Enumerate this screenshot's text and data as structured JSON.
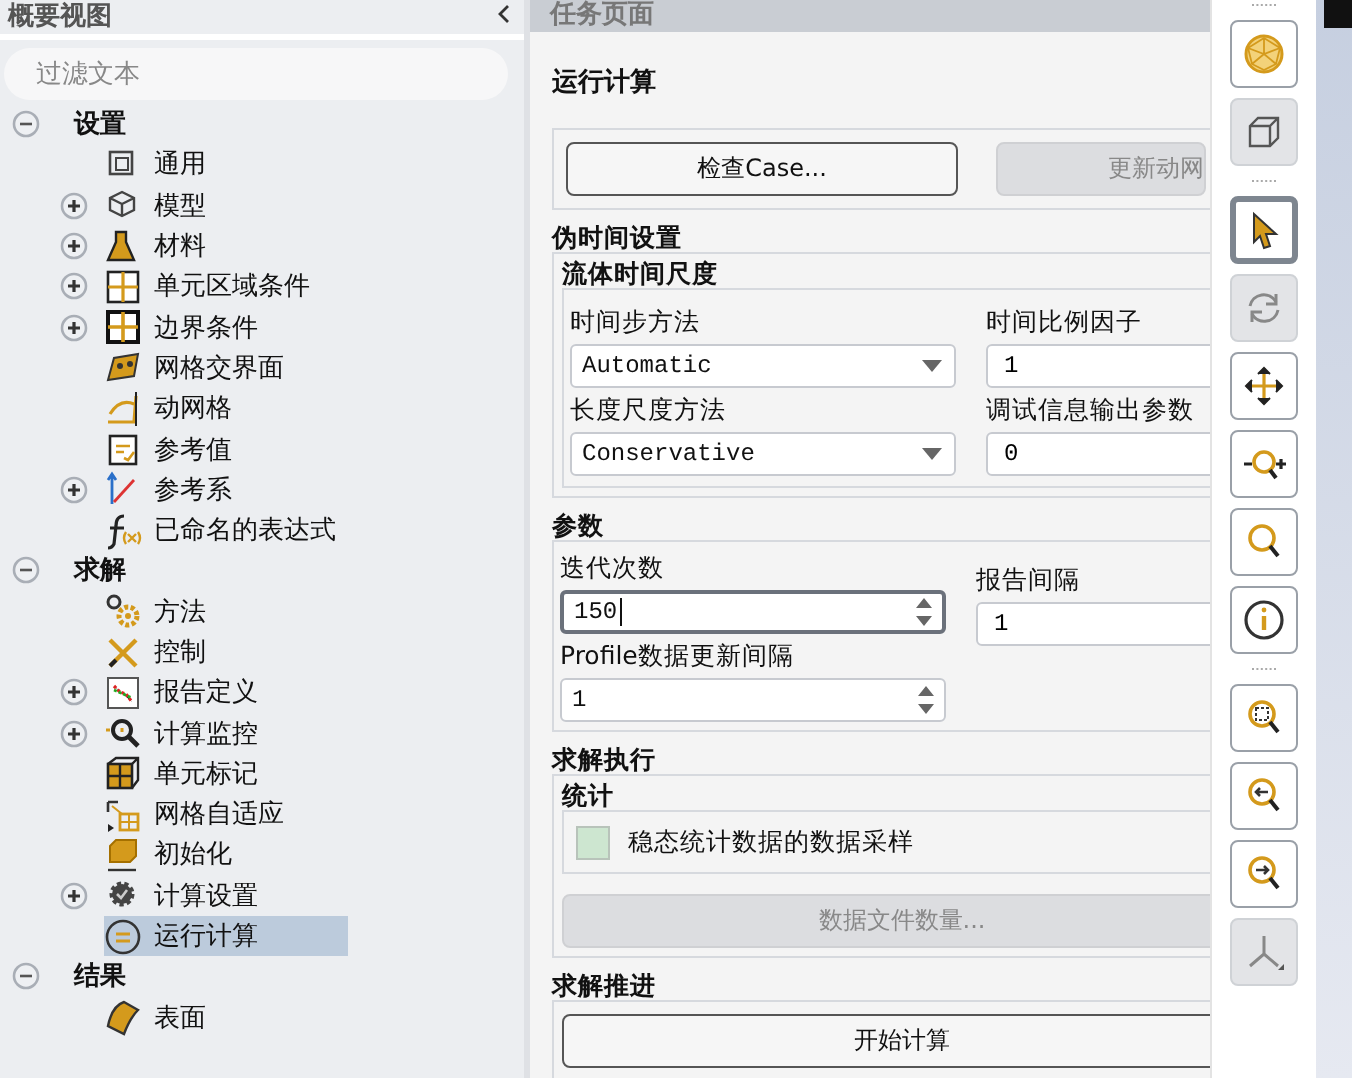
{
  "outline": {
    "title": "概要视图",
    "filter": {
      "placeholder": "过滤文本"
    },
    "groups": [
      {
        "label": "设置",
        "expanded": true,
        "children": [
          {
            "label": "通用",
            "has_children": false,
            "selected": false
          },
          {
            "label": "模型",
            "has_children": true,
            "selected": false
          },
          {
            "label": "材料",
            "has_children": true,
            "selected": false
          },
          {
            "label": "单元区域条件",
            "has_children": true,
            "selected": false
          },
          {
            "label": "边界条件",
            "has_children": true,
            "selected": false
          },
          {
            "label": "网格交界面",
            "has_children": false,
            "selected": false
          },
          {
            "label": "动网格",
            "has_children": false,
            "selected": false
          },
          {
            "label": "参考值",
            "has_children": false,
            "selected": false
          },
          {
            "label": "参考系",
            "has_children": true,
            "selected": false
          },
          {
            "label": "已命名的表达式",
            "has_children": false,
            "selected": false
          }
        ]
      },
      {
        "label": "求解",
        "expanded": true,
        "children": [
          {
            "label": "方法",
            "has_children": false,
            "selected": false
          },
          {
            "label": "控制",
            "has_children": false,
            "selected": false
          },
          {
            "label": "报告定义",
            "has_children": true,
            "selected": false
          },
          {
            "label": "计算监控",
            "has_children": true,
            "selected": false
          },
          {
            "label": "单元标记",
            "has_children": false,
            "selected": false
          },
          {
            "label": "网格自适应",
            "has_children": false,
            "selected": false
          },
          {
            "label": "初始化",
            "has_children": false,
            "selected": false
          },
          {
            "label": "计算设置",
            "has_children": true,
            "selected": false
          },
          {
            "label": "运行计算",
            "has_children": false,
            "selected": true
          }
        ]
      },
      {
        "label": "结果",
        "expanded": true,
        "children": [
          {
            "label": "表面",
            "has_children": false,
            "selected": false
          }
        ]
      }
    ]
  },
  "task_page": {
    "title": "任务页面",
    "heading": "运行计算",
    "top_buttons": [
      {
        "label": "检查Case...",
        "disabled": false
      },
      {
        "label": "更新动网",
        "disabled": true
      }
    ],
    "pseudo_time": {
      "title": "伪时间设置",
      "group_title": "流体时间尺度",
      "time_step_method": {
        "label": "时间步方法",
        "value": "Automatic"
      },
      "time_scale_factor": {
        "label": "时间比例因子",
        "value": "1"
      },
      "length_scale_method": {
        "label": "长度尺度方法",
        "value": "Conservative"
      },
      "verbosity": {
        "label": "调试信息输出参数",
        "value": "0"
      }
    },
    "parameters": {
      "title": "参数",
      "iterations": {
        "label": "迭代次数",
        "value": "150",
        "focused": true
      },
      "report_interval": {
        "label": "报告间隔",
        "value": "1"
      },
      "profile_update": {
        "label": "Profile数据更新间隔",
        "value": "1",
        "focused": false
      }
    },
    "execution": {
      "title": "求解执行",
      "group_title": "统计",
      "sampling": {
        "label": "稳态统计数据的数据采样",
        "checked": false
      },
      "data_file_button": {
        "label": "数据文件数量...",
        "disabled": true
      }
    },
    "advance": {
      "title": "求解推进",
      "button": {
        "label": "开始计算",
        "disabled": false
      }
    }
  },
  "toolbar": {
    "groups": [
      [
        {
          "selected": false,
          "disabled": false
        },
        {
          "selected": false,
          "disabled": true
        }
      ],
      [
        {
          "selected": true,
          "disabled": false
        },
        {
          "selected": false,
          "disabled": true
        },
        {
          "selected": false,
          "disabled": false
        },
        {
          "selected": false,
          "disabled": false
        },
        {
          "selected": false,
          "disabled": false
        },
        {
          "selected": false,
          "disabled": false
        }
      ],
      [
        {
          "selected": false,
          "disabled": false
        },
        {
          "selected": false,
          "disabled": false
        },
        {
          "selected": false,
          "disabled": false
        },
        {
          "selected": false,
          "disabled": true
        }
      ]
    ]
  }
}
